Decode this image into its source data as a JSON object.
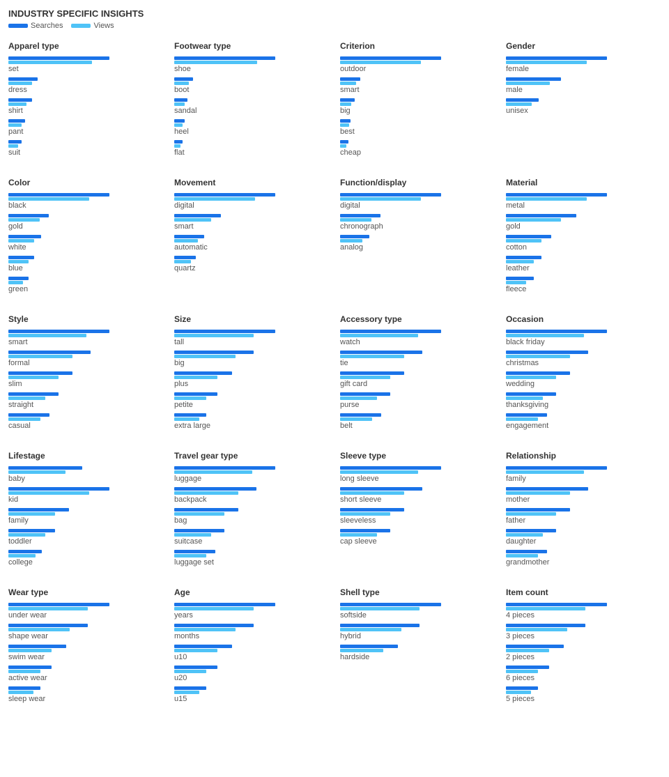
{
  "header": {
    "title": "INDUSTRY SPECIFIC INSIGHTS",
    "searches_label": "Searches",
    "views_label": "Views"
  },
  "sections": [
    {
      "id": "apparel-type",
      "title": "Apparel type",
      "items": [
        {
          "label": "set",
          "search": 120,
          "view": 100
        },
        {
          "label": "dress",
          "search": 35,
          "view": 28
        },
        {
          "label": "shirt",
          "search": 28,
          "view": 22
        },
        {
          "label": "pant",
          "search": 20,
          "view": 16
        },
        {
          "label": "suit",
          "search": 16,
          "view": 12
        }
      ]
    },
    {
      "id": "footwear-type",
      "title": "Footwear type",
      "items": [
        {
          "label": "shoe",
          "search": 170,
          "view": 140
        },
        {
          "label": "boot",
          "search": 32,
          "view": 25
        },
        {
          "label": "sandal",
          "search": 22,
          "view": 18
        },
        {
          "label": "heel",
          "search": 18,
          "view": 14
        },
        {
          "label": "flat",
          "search": 14,
          "view": 11
        }
      ]
    },
    {
      "id": "criterion",
      "title": "Criterion",
      "items": [
        {
          "label": "outdoor",
          "search": 150,
          "view": 120
        },
        {
          "label": "smart",
          "search": 30,
          "view": 24
        },
        {
          "label": "big",
          "search": 22,
          "view": 17
        },
        {
          "label": "best",
          "search": 16,
          "view": 13
        },
        {
          "label": "cheap",
          "search": 12,
          "view": 9
        }
      ]
    },
    {
      "id": "gender",
      "title": "Gender",
      "items": [
        {
          "label": "female",
          "search": 55,
          "view": 44
        },
        {
          "label": "male",
          "search": 30,
          "view": 24
        },
        {
          "label": "unisex",
          "search": 18,
          "view": 14
        }
      ]
    },
    {
      "id": "color",
      "title": "Color",
      "items": [
        {
          "label": "black",
          "search": 55,
          "view": 44
        },
        {
          "label": "gold",
          "search": 22,
          "view": 17
        },
        {
          "label": "white",
          "search": 18,
          "view": 14
        },
        {
          "label": "blue",
          "search": 14,
          "view": 11
        },
        {
          "label": "green",
          "search": 11,
          "view": 8
        }
      ]
    },
    {
      "id": "movement",
      "title": "Movement",
      "items": [
        {
          "label": "digital",
          "search": 60,
          "view": 48
        },
        {
          "label": "smart",
          "search": 28,
          "view": 22
        },
        {
          "label": "automatic",
          "search": 18,
          "view": 14
        },
        {
          "label": "quartz",
          "search": 13,
          "view": 10
        }
      ]
    },
    {
      "id": "function-display",
      "title": "Function/display",
      "items": [
        {
          "label": "digital",
          "search": 55,
          "view": 44
        },
        {
          "label": "chronograph",
          "search": 22,
          "view": 17
        },
        {
          "label": "analog",
          "search": 16,
          "view": 12
        }
      ]
    },
    {
      "id": "material",
      "title": "Material",
      "items": [
        {
          "label": "metal",
          "search": 40,
          "view": 32
        },
        {
          "label": "gold",
          "search": 28,
          "view": 22
        },
        {
          "label": "cotton",
          "search": 18,
          "view": 14
        },
        {
          "label": "leather",
          "search": 14,
          "view": 11
        },
        {
          "label": "fleece",
          "search": 11,
          "view": 8
        }
      ]
    },
    {
      "id": "style",
      "title": "Style",
      "items": [
        {
          "label": "smart",
          "search": 22,
          "view": 17
        },
        {
          "label": "formal",
          "search": 18,
          "view": 14
        },
        {
          "label": "slim",
          "search": 14,
          "view": 11
        },
        {
          "label": "straight",
          "search": 11,
          "view": 8
        },
        {
          "label": "casual",
          "search": 9,
          "view": 7
        }
      ]
    },
    {
      "id": "size",
      "title": "Size",
      "items": [
        {
          "label": "tall",
          "search": 28,
          "view": 22
        },
        {
          "label": "big",
          "search": 22,
          "view": 17
        },
        {
          "label": "plus",
          "search": 16,
          "view": 12
        },
        {
          "label": "petite",
          "search": 12,
          "view": 9
        },
        {
          "label": "extra large",
          "search": 9,
          "view": 7
        }
      ]
    },
    {
      "id": "accessory-type",
      "title": "Accessory type",
      "items": [
        {
          "label": "watch",
          "search": 22,
          "view": 17
        },
        {
          "label": "tie",
          "search": 18,
          "view": 14
        },
        {
          "label": "gift card",
          "search": 14,
          "view": 11
        },
        {
          "label": "purse",
          "search": 11,
          "view": 8
        },
        {
          "label": "belt",
          "search": 9,
          "view": 7
        }
      ]
    },
    {
      "id": "occasion",
      "title": "Occasion",
      "items": [
        {
          "label": "black friday",
          "search": 22,
          "view": 17
        },
        {
          "label": "christmas",
          "search": 18,
          "view": 14
        },
        {
          "label": "wedding",
          "search": 14,
          "view": 11
        },
        {
          "label": "thanksgiving",
          "search": 11,
          "view": 8
        },
        {
          "label": "engagement",
          "search": 9,
          "view": 7
        }
      ]
    },
    {
      "id": "lifestage",
      "title": "Lifestage",
      "items": [
        {
          "label": "baby",
          "search": 22,
          "view": 17
        },
        {
          "label": "kid",
          "search": 30,
          "view": 24
        },
        {
          "label": "family",
          "search": 18,
          "view": 14
        },
        {
          "label": "toddler",
          "search": 14,
          "view": 11
        },
        {
          "label": "college",
          "search": 10,
          "view": 8
        }
      ]
    },
    {
      "id": "travel-gear-type",
      "title": "Travel gear type",
      "items": [
        {
          "label": "luggage",
          "search": 22,
          "view": 17
        },
        {
          "label": "backpack",
          "search": 18,
          "view": 14
        },
        {
          "label": "bag",
          "search": 14,
          "view": 11
        },
        {
          "label": "suitcase",
          "search": 11,
          "view": 8
        },
        {
          "label": "luggage set",
          "search": 9,
          "view": 7
        }
      ]
    },
    {
      "id": "sleeve-type",
      "title": "Sleeve type",
      "items": [
        {
          "label": "long sleeve",
          "search": 22,
          "view": 17
        },
        {
          "label": "short sleeve",
          "search": 18,
          "view": 14
        },
        {
          "label": "sleeveless",
          "search": 14,
          "view": 11
        },
        {
          "label": "cap sleeve",
          "search": 11,
          "view": 8
        }
      ]
    },
    {
      "id": "relationship",
      "title": "Relationship",
      "items": [
        {
          "label": "family",
          "search": 22,
          "view": 17
        },
        {
          "label": "mother",
          "search": 18,
          "view": 14
        },
        {
          "label": "father",
          "search": 14,
          "view": 11
        },
        {
          "label": "daughter",
          "search": 11,
          "view": 8
        },
        {
          "label": "grandmother",
          "search": 9,
          "view": 7
        }
      ]
    },
    {
      "id": "wear-type",
      "title": "Wear type",
      "items": [
        {
          "label": "under wear",
          "search": 28,
          "view": 22
        },
        {
          "label": "shape wear",
          "search": 22,
          "view": 17
        },
        {
          "label": "swim wear",
          "search": 16,
          "view": 12
        },
        {
          "label": "active wear",
          "search": 12,
          "view": 9
        },
        {
          "label": "sleep wear",
          "search": 9,
          "view": 7
        }
      ]
    },
    {
      "id": "age",
      "title": "Age",
      "items": [
        {
          "label": "years",
          "search": 28,
          "view": 22
        },
        {
          "label": "months",
          "search": 22,
          "view": 17
        },
        {
          "label": "u10",
          "search": 16,
          "view": 12
        },
        {
          "label": "u20",
          "search": 12,
          "view": 9
        },
        {
          "label": "u15",
          "search": 9,
          "view": 7
        }
      ]
    },
    {
      "id": "shell-type",
      "title": "Shell type",
      "items": [
        {
          "label": "softside",
          "search": 28,
          "view": 22
        },
        {
          "label": "hybrid",
          "search": 22,
          "view": 17
        },
        {
          "label": "hardside",
          "search": 16,
          "view": 12
        }
      ]
    },
    {
      "id": "item-count",
      "title": "Item count",
      "items": [
        {
          "label": "4 pieces",
          "search": 28,
          "view": 22
        },
        {
          "label": "3 pieces",
          "search": 22,
          "view": 17
        },
        {
          "label": "2 pieces",
          "search": 16,
          "view": 12
        },
        {
          "label": "6 pieces",
          "search": 12,
          "view": 9
        },
        {
          "label": "5 pieces",
          "search": 9,
          "view": 7
        }
      ]
    }
  ],
  "max_bar_width": 170
}
